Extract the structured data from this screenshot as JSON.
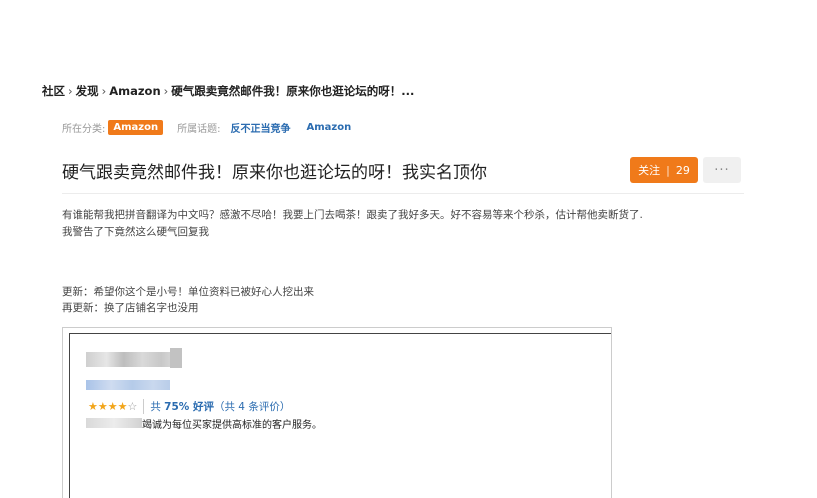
{
  "breadcrumb": {
    "items": [
      "社区",
      "发现",
      "Amazon",
      "硬气跟卖竟然邮件我！原来你也逛论坛的呀！..."
    ],
    "separator": "›"
  },
  "meta": {
    "category_label": "所在分类:",
    "category": "Amazon",
    "topic_label": "所属话题:",
    "topics": [
      "反不正当竞争",
      "Amazon"
    ]
  },
  "post": {
    "title": "硬气跟卖竟然邮件我！原来你也逛论坛的呀！我实名顶你",
    "body_line1": "有谁能帮我把拼音翻译为中文吗？感激不尽哈！我要上门去喝茶！跟卖了我好多天。好不容易等来个秒杀，估计帮他卖断货了.",
    "body_line2": "我警告了下竟然这么硬气回复我",
    "update1": "更新：希望你这个是小号！单位资料已被好心人挖出来",
    "update2": "再更新：换了店铺名字也没用"
  },
  "actions": {
    "follow_label": "关注",
    "follow_count": "29",
    "more_label": "···"
  },
  "screenshot": {
    "stars_filled": "★★★★",
    "stars_empty": "☆",
    "rating_prefix": "共 ",
    "rating_percent": "75% 好评",
    "rating_count": "（共 4 条评价）",
    "seller_text": "竭诚为每位买家提供高标准的客户服务。"
  },
  "colors": {
    "accent": "#f07a1a",
    "link": "#2b6cb0",
    "star": "#f2a51a"
  }
}
